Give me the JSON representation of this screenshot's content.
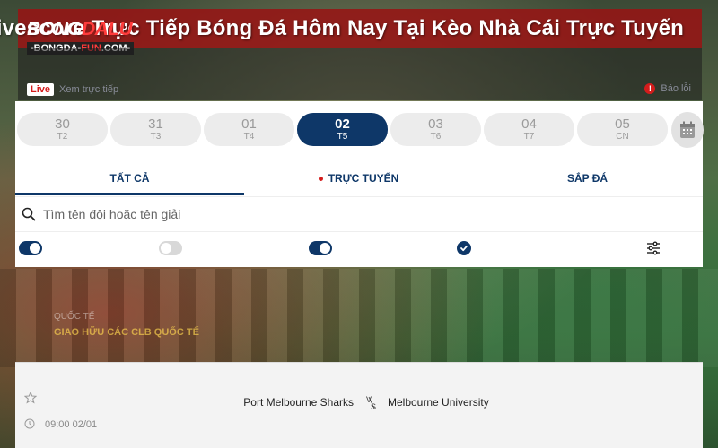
{
  "banner": {
    "title": "Livescore Trực Tiếp Bóng Đá Hôm Nay Tại Kèo Nhà Cái Trực Tuyến"
  },
  "logo": {
    "main_white": "BONG",
    "main_red": "DALU",
    "sub_white": "-BONGDA-",
    "sub_red": "FUN",
    "sub_end": ".COM-"
  },
  "live_bar": {
    "badge": "Live",
    "text": "Xem trực tiếp"
  },
  "report": {
    "text": "Báo lỗi"
  },
  "dates": [
    {
      "day": "30",
      "weekday": "T2",
      "active": false
    },
    {
      "day": "31",
      "weekday": "T3",
      "active": false
    },
    {
      "day": "01",
      "weekday": "T4",
      "active": false
    },
    {
      "day": "02",
      "weekday": "T5",
      "active": true
    },
    {
      "day": "03",
      "weekday": "T6",
      "active": false
    },
    {
      "day": "04",
      "weekday": "T7",
      "active": false
    },
    {
      "day": "05",
      "weekday": "CN",
      "active": false
    }
  ],
  "tabs": {
    "all": "TẤT CẢ",
    "live": "TRỰC TUYẾN",
    "upcoming": "SẮP ĐÁ"
  },
  "search": {
    "placeholder": "Tìm tên đội hoặc tên giải"
  },
  "toggles": [
    {
      "state": "on"
    },
    {
      "state": "off"
    },
    {
      "state": "on"
    }
  ],
  "league": {
    "category": "QUỐC TẾ",
    "name": "GIAO HỮU CÁC CLB QUỐC TẾ"
  },
  "match": {
    "time": "09:00 02/01",
    "home": "Port Melbourne Sharks",
    "away": "Melbourne University"
  },
  "colors": {
    "primary": "#0e3768",
    "banner": "#961414",
    "live_red": "#d41c1c"
  }
}
